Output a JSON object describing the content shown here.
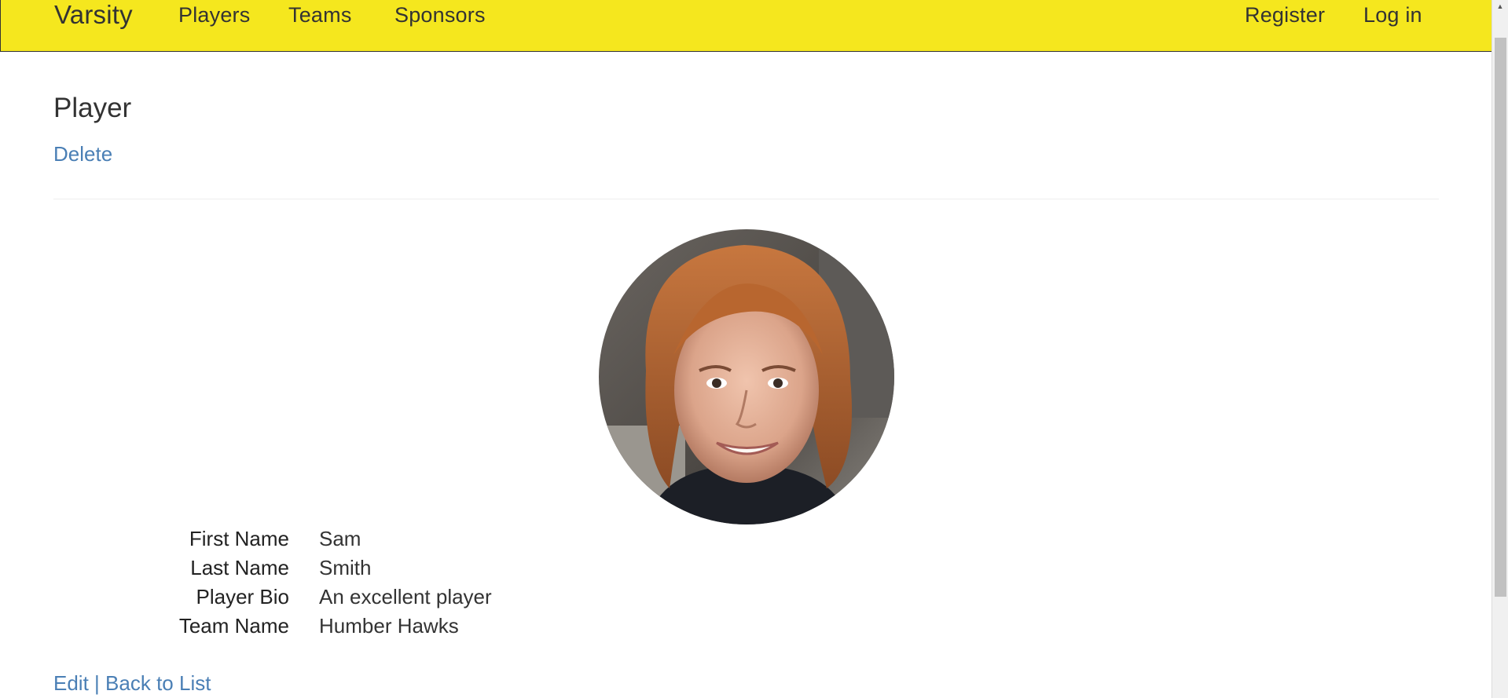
{
  "nav": {
    "brand": "Varsity",
    "links": [
      "Players",
      "Teams",
      "Sponsors"
    ],
    "register": "Register",
    "login": "Log in"
  },
  "page": {
    "title": "Player",
    "delete_label": "Delete"
  },
  "player": {
    "fields": [
      {
        "label": "First Name",
        "value": "Sam"
      },
      {
        "label": "Last Name",
        "value": "Smith"
      },
      {
        "label": "Player Bio",
        "value": "An excellent player"
      },
      {
        "label": "Team Name",
        "value": "Humber Hawks"
      }
    ]
  },
  "footer": {
    "edit": "Edit",
    "separator": "|",
    "back": "Back to List"
  },
  "colors": {
    "navbar": "#f5e71e",
    "link": "#4a7fb5"
  }
}
